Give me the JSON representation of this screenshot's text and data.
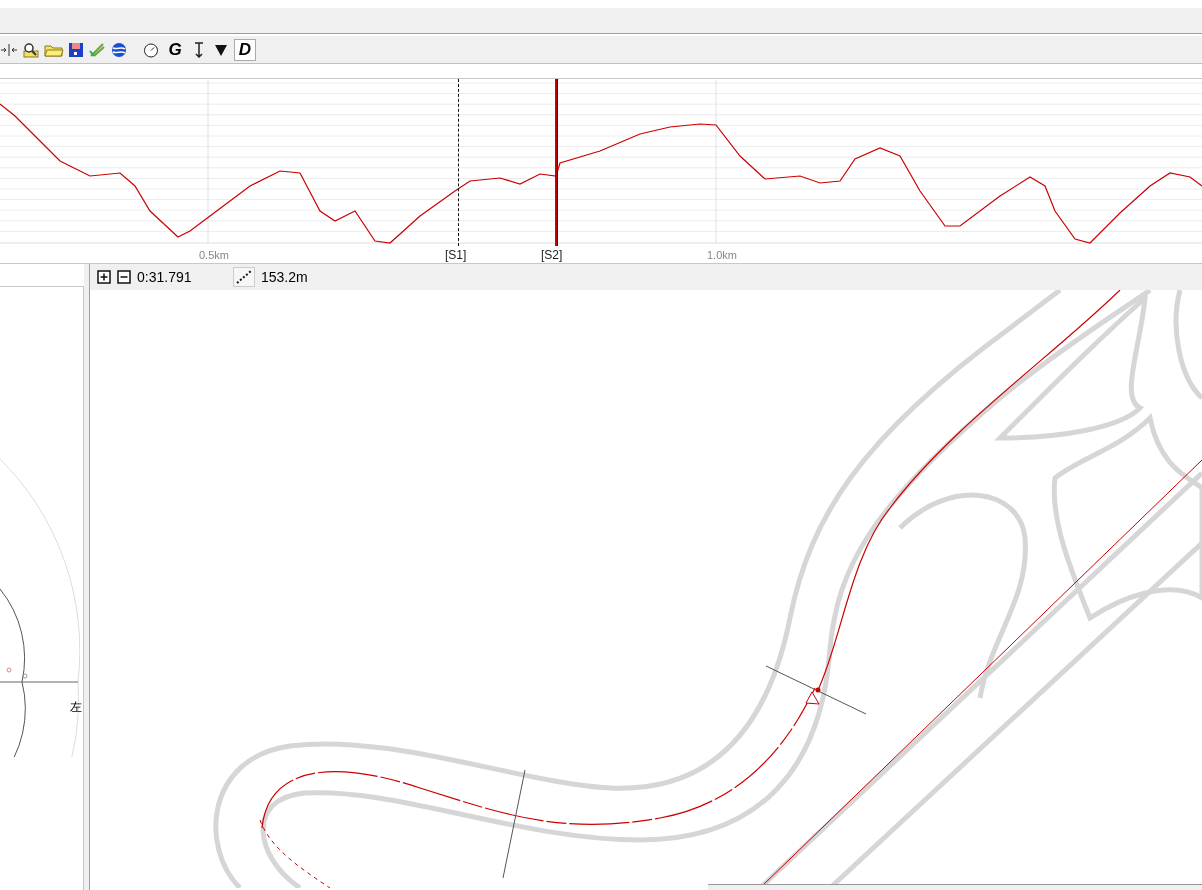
{
  "toolbar": {
    "letter_buttons": [
      {
        "label": "G",
        "pressed": false
      },
      {
        "label": "D",
        "pressed": true
      }
    ]
  },
  "elevation_chart": {
    "x_labels": [
      "0.5km",
      "1.0km"
    ],
    "markers": [
      {
        "label": "[S1]",
        "current": false
      },
      {
        "label": "[S2]",
        "current": true
      }
    ]
  },
  "side_panel": {
    "axis_label": "左"
  },
  "map_toolbar": {
    "lap_time": "0:31.791",
    "distance": "153.2m"
  }
}
